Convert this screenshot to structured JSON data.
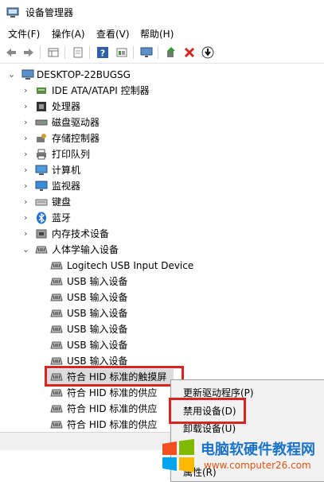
{
  "window": {
    "title": "设备管理器"
  },
  "menu": [
    "文件(F)",
    "操作(A)",
    "查看(V)",
    "帮助(H)"
  ],
  "toolbar": [
    {
      "icon": "back-arrow-icon"
    },
    {
      "icon": "forward-arrow-icon"
    },
    {
      "icon": "properties-grid-icon"
    },
    {
      "icon": "document-icon"
    },
    {
      "icon": "help-icon"
    },
    {
      "icon": "show-hidden-icon"
    },
    {
      "icon": "monitor-icon"
    },
    {
      "icon": "update-driver-icon"
    },
    {
      "icon": "uninstall-x-icon"
    },
    {
      "icon": "download-arrow-icon"
    }
  ],
  "tree": {
    "root": "DESKTOP-22BUGSG",
    "categories": [
      {
        "label": "IDE ATA/ATAPI 控制器"
      },
      {
        "label": "处理器"
      },
      {
        "label": "磁盘驱动器"
      },
      {
        "label": "存储控制器"
      },
      {
        "label": "打印队列"
      },
      {
        "label": "计算机"
      },
      {
        "label": "监视器"
      },
      {
        "label": "键盘"
      },
      {
        "label": "蓝牙"
      },
      {
        "label": "内存技术设备"
      },
      {
        "label": "人体学输入设备"
      }
    ],
    "hid_children": [
      "Logitech USB Input Device",
      "USB 输入设备",
      "USB 输入设备",
      "USB 输入设备",
      "USB 输入设备",
      "USB 输入设备",
      "USB 输入设备",
      "符合 HID 标准的触摸屏",
      "符合 HID 标准的供应",
      "符合 HID 标准的供应",
      "符合 HID 标准的供应"
    ]
  },
  "context_menu": {
    "items": [
      "更新驱动程序(P)",
      "禁用设备(D)",
      "卸载设备(U)",
      "属性(R)"
    ]
  },
  "watermark": {
    "title": "电脑软硬件教程网",
    "url": "www.computer26.com"
  },
  "colors": {
    "highlight": "#d9251d",
    "watermark_blue": "#1a73c9"
  }
}
